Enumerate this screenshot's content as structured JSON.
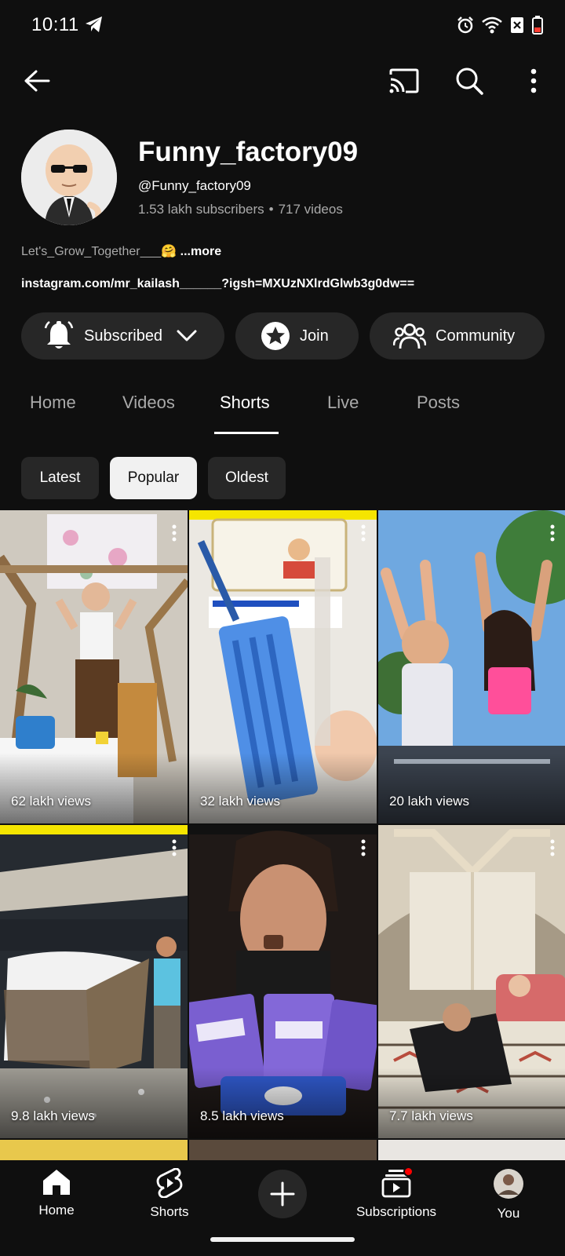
{
  "status_bar": {
    "time": "10:11"
  },
  "channel": {
    "name": "Funny_factory09",
    "handle": "@Funny_factory09",
    "subscribers": "1.53 lakh subscribers",
    "separator": "•",
    "videos": "717 videos",
    "description": "Let's_Grow_Together___🤗",
    "more_label": "...more",
    "link": "instagram.com/mr_kailash______?igsh=MXUzNXlrdGlwb3g0dw=="
  },
  "actions": {
    "subscribed": "Subscribed",
    "join": "Join",
    "community": "Community"
  },
  "tabs": [
    {
      "label": "Home"
    },
    {
      "label": "Videos"
    },
    {
      "label": "Shorts",
      "active": true
    },
    {
      "label": "Live"
    },
    {
      "label": "Posts"
    }
  ],
  "chips": [
    {
      "label": "Latest"
    },
    {
      "label": "Popular",
      "selected": true
    },
    {
      "label": "Oldest"
    }
  ],
  "shorts": [
    {
      "views": "62 lakh views"
    },
    {
      "views": "32 lakh views"
    },
    {
      "views": "20 lakh views"
    },
    {
      "views": "9.8 lakh views"
    },
    {
      "views": "8.5 lakh views"
    },
    {
      "views": "7.7 lakh views"
    }
  ],
  "bottom_nav": {
    "home": "Home",
    "shorts": "Shorts",
    "subscriptions": "Subscriptions",
    "you": "You"
  },
  "colors": {
    "background": "#0f0f0f",
    "button_bg": "#272727",
    "secondary_text": "#aaaaaa",
    "notification_dot": "#ff0000"
  }
}
